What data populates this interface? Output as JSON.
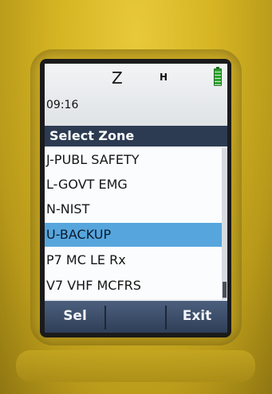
{
  "status": {
    "zone_indicator": "Z",
    "mode_indicator": "H",
    "time": "09:16",
    "battery_icon": "battery-full-icon"
  },
  "menu": {
    "title": "Select Zone",
    "items": [
      {
        "label": "J-PUBL SAFETY",
        "selected": false
      },
      {
        "label": "L-GOVT EMG",
        "selected": false
      },
      {
        "label": "N-NIST",
        "selected": false
      },
      {
        "label": "U-BACKUP",
        "selected": true
      },
      {
        "label": "P7 MC LE Rx",
        "selected": false
      },
      {
        "label": "V7 VHF MCFRS",
        "selected": false
      }
    ]
  },
  "softkeys": {
    "left": "Sel",
    "middle": "",
    "right": "Exit"
  },
  "colors": {
    "housing": "#d6b523",
    "title_bar": "#2c3b52",
    "selection": "#56a6dd",
    "softkey_bar": "#3c4e6a"
  }
}
